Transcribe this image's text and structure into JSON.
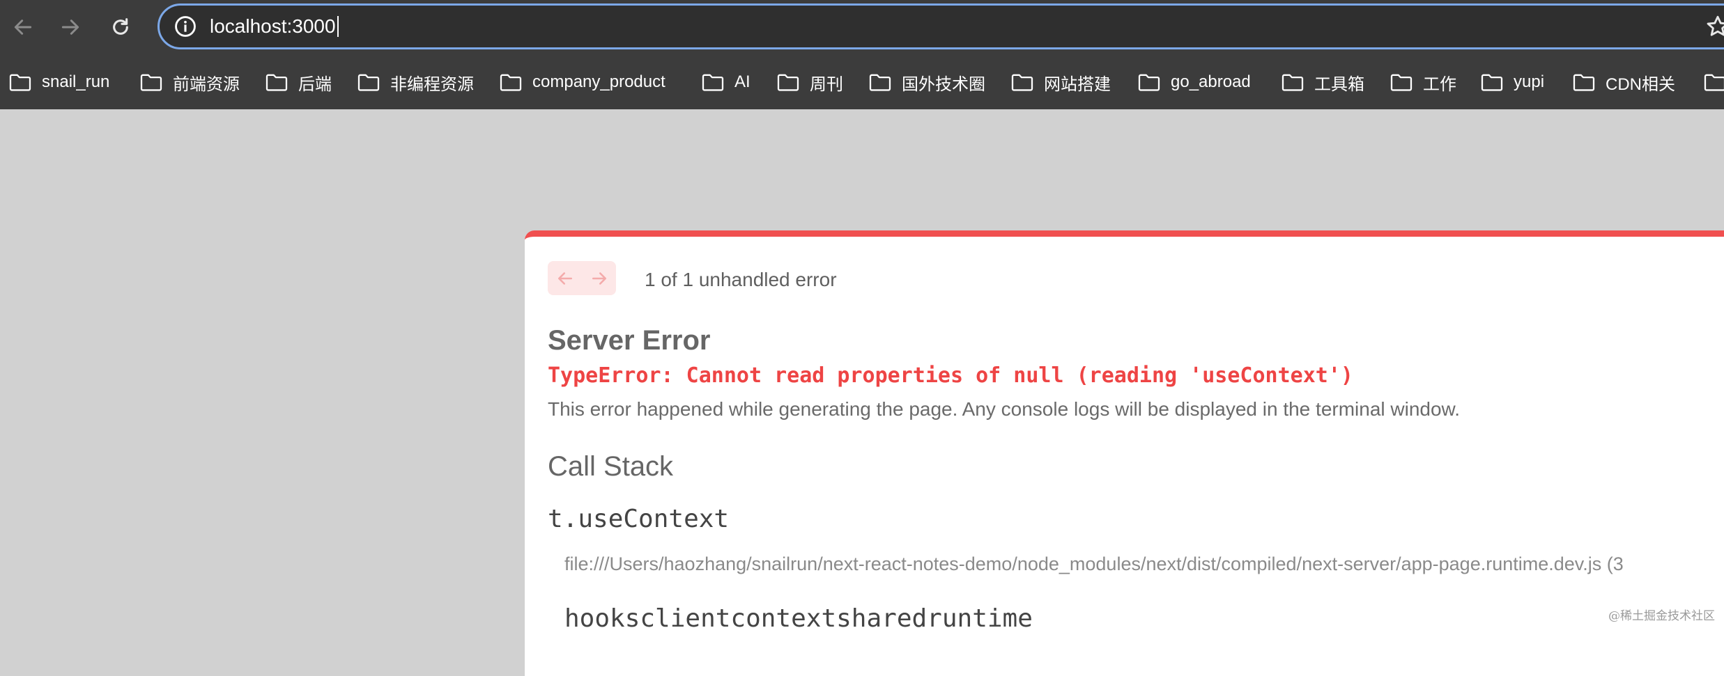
{
  "browser": {
    "url": "localhost:3000",
    "bookmarks": [
      "snail_run",
      "前端资源",
      "后端",
      "非编程资源",
      "company_product",
      "AI",
      "周刊",
      "国外技术圈",
      "网站搭建",
      "go_abroad",
      "工具箱",
      "工作",
      "yupi",
      "CDN相关",
      ""
    ]
  },
  "error_overlay": {
    "count_text": "1 of 1 unhandled error",
    "title": "Server Error",
    "type_error": "TypeError: Cannot read properties of null (reading 'useContext')",
    "description": "This error happened while generating the page. Any console logs will be displayed in the terminal window.",
    "call_stack_heading": "Call Stack",
    "frames": [
      {
        "name": "t.useContext",
        "file": "file:///Users/haozhang/snailrun/next-react-notes-demo/node_modules/next/dist/compiled/next-server/app-page.runtime.dev.js (3"
      },
      {
        "name": "hooksclientcontextsharedruntime"
      }
    ]
  },
  "watermark": "@稀土掘金技术社区",
  "colors": {
    "accent_red": "#f04f4f",
    "omnibox_border": "#7ca8e8",
    "chrome_bg": "#3c3c3c",
    "backdrop": "#d1d1d1"
  }
}
